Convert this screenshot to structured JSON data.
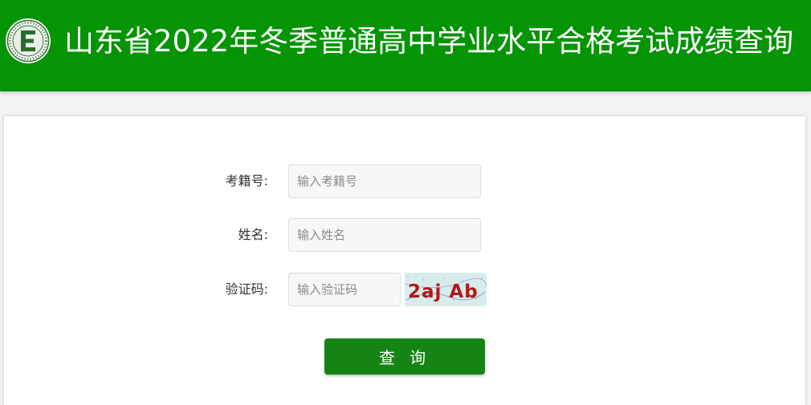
{
  "header": {
    "title": "山东省2022年冬季普通高中学业水平合格考试成绩查询",
    "logo_icon": "exam-logo-icon",
    "logo_letter": "E",
    "background_color": "#049404"
  },
  "form": {
    "exam_id": {
      "label": "考籍号:",
      "placeholder": "输入考籍号",
      "value": ""
    },
    "name": {
      "label": "姓名:",
      "placeholder": "输入姓名",
      "value": ""
    },
    "captcha": {
      "label": "验证码:",
      "placeholder": "输入验证码",
      "value": "",
      "image_text": "2aj Ab"
    },
    "submit_label": "查 询"
  },
  "colors": {
    "accent": "#049404",
    "button": "#158415",
    "page_background": "#f2f2f2"
  }
}
